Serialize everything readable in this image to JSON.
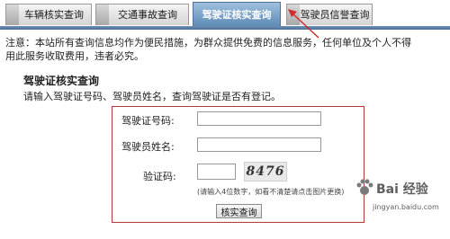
{
  "tabs": [
    {
      "label": "车辆核实查询",
      "active": false
    },
    {
      "label": "交通事故查询",
      "active": false
    },
    {
      "label": "驾驶证核实查询",
      "active": true
    },
    {
      "label": "驾驶员信誉查询",
      "active": false
    }
  ],
  "notice": {
    "line1": "注意：本站所有查询信息均作为便民措施，为群众提供免费的信息服务，任何单位及个人不得",
    "line2": "用此服务收取费用，违者必究。"
  },
  "section_title": "驾驶证核实查询",
  "instruction": "请输入驾驶证号码、驾驶员姓名，查询驾驶证是否有登记。",
  "form": {
    "license_label": "驾驶证号码:",
    "license_value": "",
    "name_label": "驾驶员姓名:",
    "name_value": "",
    "captcha_label": "验证码:",
    "captcha_value": "",
    "captcha_image_text": "8476",
    "captcha_hint": "(请输入4位数字，如看不清楚请点击图片更换)",
    "submit_label": "核实查询"
  },
  "watermark": {
    "brand": "Bai 经验",
    "url": "jingyan.baidu.com"
  },
  "colors": {
    "active_tab": "#5e8bb6",
    "form_border": "#b23a3a",
    "arrow": "#d22b2b"
  }
}
